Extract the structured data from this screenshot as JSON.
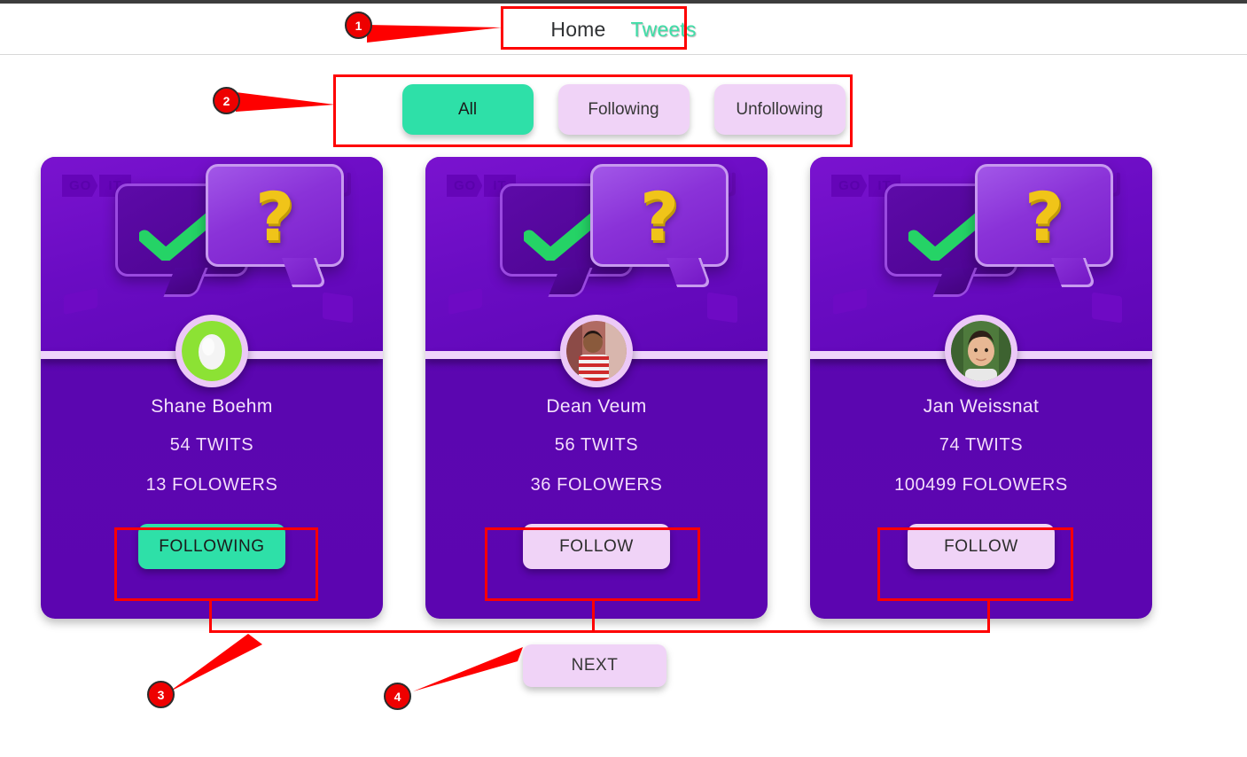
{
  "header": {
    "nav": [
      {
        "label": "Home",
        "active": false
      },
      {
        "label": "Tweets",
        "active": true
      }
    ]
  },
  "filters": {
    "buttons": [
      {
        "label": "All",
        "active": true
      },
      {
        "label": "Following",
        "active": false
      },
      {
        "label": "Unfollowing",
        "active": false
      }
    ]
  },
  "cards": [
    {
      "logo_go": "GO",
      "logo_it": "IT",
      "name": "Shane Boehm",
      "tweets": "54 TWITS",
      "followers": "13 FOLOWERS",
      "button_label": "FOLLOWING",
      "following": true,
      "avatar_type": "egg-default-avatar"
    },
    {
      "logo_go": "GO",
      "logo_it": "IT",
      "name": "Dean Veum",
      "tweets": "56 TWITS",
      "followers": "36 FOLOWERS",
      "button_label": "FOLLOW",
      "following": false,
      "avatar_type": "photo-striped-shirt"
    },
    {
      "logo_go": "GO",
      "logo_it": "IT",
      "name": "Jan Weissnat",
      "tweets": "74 TWITS",
      "followers": "100499 FOLOWERS",
      "button_label": "FOLLOW",
      "following": false,
      "avatar_type": "photo-green-background"
    }
  ],
  "pagination": {
    "next_label": "NEXT"
  },
  "annotations": [
    {
      "number": "1"
    },
    {
      "number": "2"
    },
    {
      "number": "3"
    },
    {
      "number": "4"
    }
  ],
  "colors": {
    "accent_green": "#2ee0a8",
    "button_lavender": "#f0d3f7",
    "card_purple": "#5c05b0",
    "annotation_red": "#fe0000",
    "question_yellow": "#f0c419"
  }
}
